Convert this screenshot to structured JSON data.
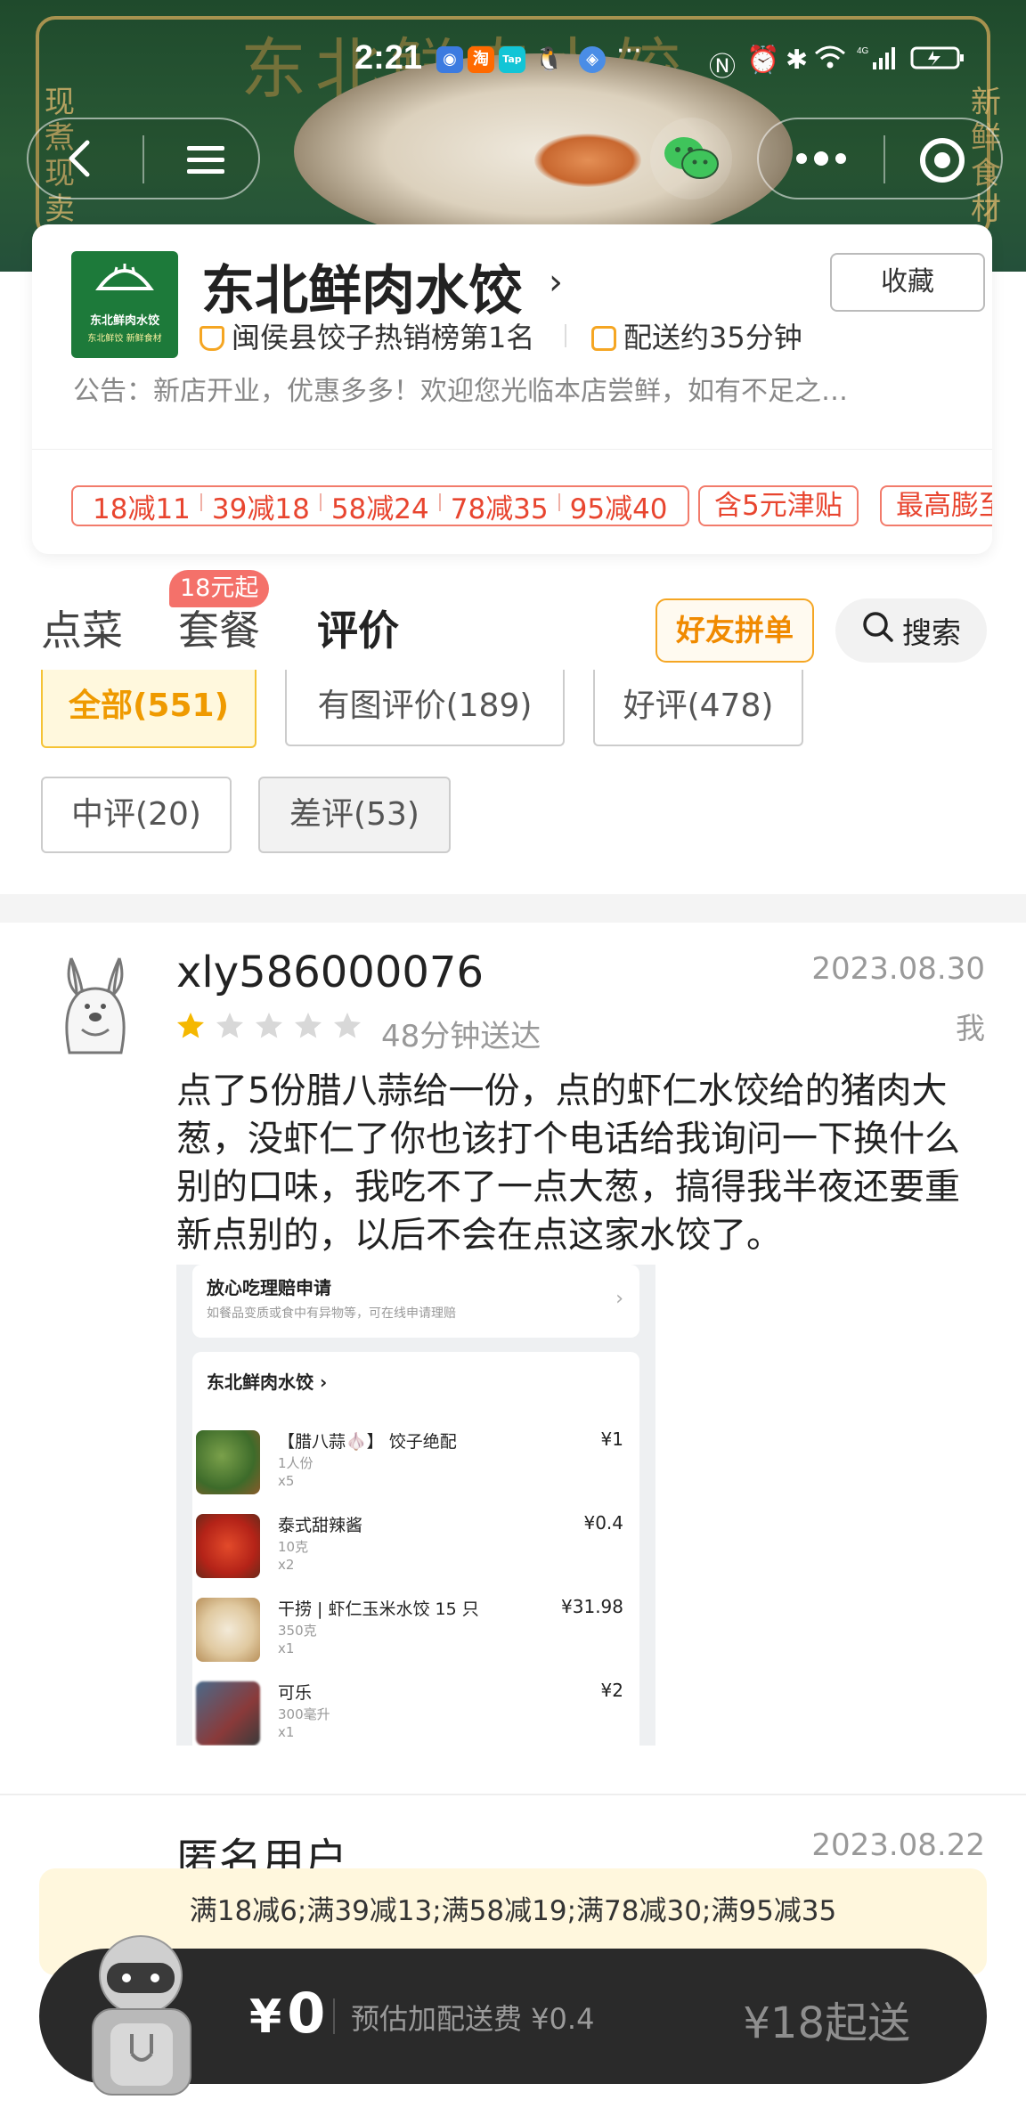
{
  "status_bar": {
    "time": "2:21",
    "more": "···"
  },
  "banner": {
    "title": "东北鲜肉水饺",
    "left_tagline": "现煮现卖",
    "right_tagline": "新鲜食材"
  },
  "nav": {
    "back_icon": "chevron-left-icon",
    "menu_icon": "hamburger-icon",
    "wechat_icon": "wechat-icon",
    "more_icon": "more-dots-icon",
    "close_icon": "target-icon"
  },
  "store": {
    "logo_line1": "东北鲜肉水饺",
    "logo_line2": "东北鲜饺 新鲜食材",
    "name": "东北鲜肉水饺",
    "arrow": "›",
    "favorite": "收藏",
    "ranking": "闽侯县饺子热销榜第1名",
    "delivery": "配送约35分钟",
    "notice": "公告：新店开业，优惠多多！欢迎您光临本店尝鲜，如有不足之…",
    "coupons": [
      "18减11",
      "39减18",
      "58减24",
      "78减35",
      "95减40"
    ],
    "subsidy": "含5元津贴",
    "max_expand": "最高膨至"
  },
  "tabs": {
    "order": "点菜",
    "combo": "套餐",
    "combo_badge": "18元起",
    "reviews": "评价",
    "friend_group": "好友拼单",
    "search": "搜索"
  },
  "filters": {
    "all": "全部(551)",
    "with_pic": "有图评价(189)",
    "good": "好评(478)",
    "medium": "中评(20)",
    "bad": "差评(53)"
  },
  "review": {
    "user": "xly586000076",
    "date": "2023.08.30",
    "me": "我",
    "rating": 1,
    "max_rating": 5,
    "delivery_time": "48分钟送达",
    "text": "点了5份腊八蒜给一份，点的虾仁水饺给的猪肉大葱，没虾仁了你也该打个电话给我询问一下换什么别的口味，我吃不了一点大葱，搞得我半夜还要重新点别的，以后不会在点这家水饺了。",
    "screenshot": {
      "claim_title": "放心吃理赔申请",
      "claim_sub": "如餐品变质或食中有异物等，可在线申请理赔",
      "store": "东北鲜肉水饺 ›",
      "items": [
        {
          "name": "【腊八蒜🧄】 饺子绝配",
          "spec": "1人份",
          "qty": "x5",
          "price": "¥1"
        },
        {
          "name": "泰式甜辣酱",
          "spec": "10克",
          "qty": "x2",
          "price": "¥0.4"
        },
        {
          "name": "干捞 | 虾仁玉米水饺 15 只",
          "spec": "350克",
          "qty": "x1",
          "price": "¥31.98"
        },
        {
          "name": "可乐",
          "spec": "300毫升",
          "qty": "x1",
          "price": "¥2"
        }
      ]
    }
  },
  "next_review": {
    "user": "匿名用户",
    "date": "2023.08.22"
  },
  "bottom": {
    "promo": "满18减6;满39减13;满58减19;满78减30;满95减35",
    "currency": "¥",
    "total": "0",
    "delivery_fee": "预估加配送费 ¥0.4",
    "min_order": "¥18起送"
  },
  "colors": {
    "accent_yellow": "#ffc700",
    "coupon_red": "#e8452f",
    "star_on": "#f5b800",
    "star_off": "#d8d8d8",
    "banner_green": "#1f4a2c"
  }
}
